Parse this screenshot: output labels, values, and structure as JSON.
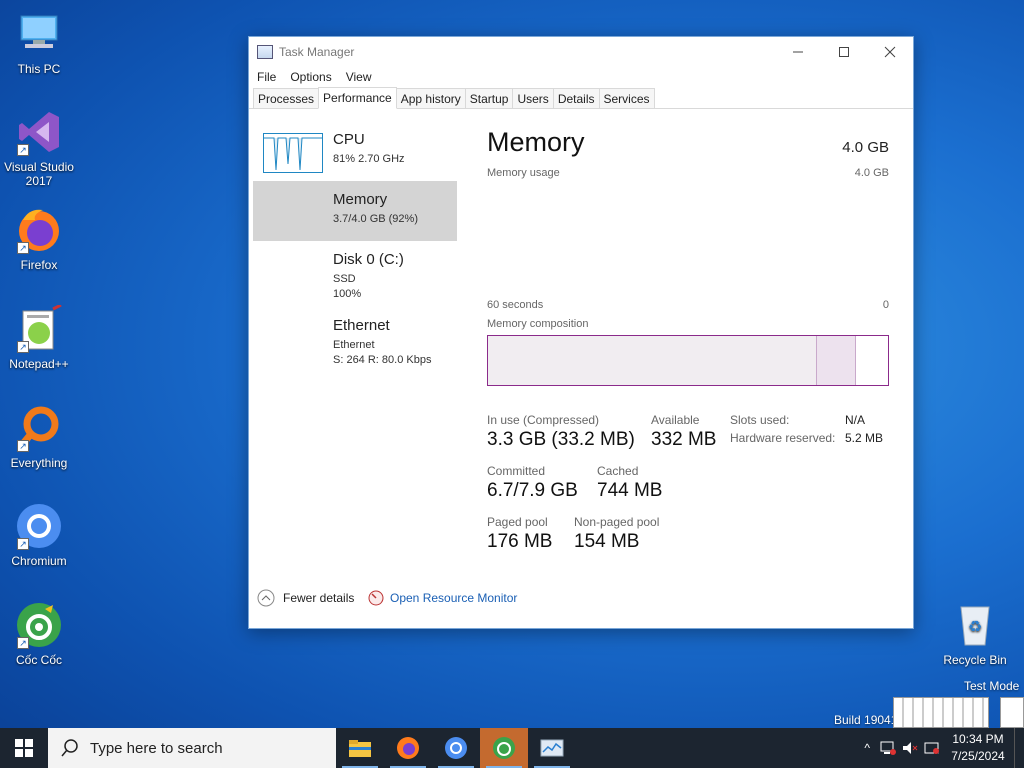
{
  "desktop": {
    "icons": [
      {
        "label": "This PC"
      },
      {
        "label": "Visual Studio 2017"
      },
      {
        "label": "Firefox"
      },
      {
        "label": "Notepad++"
      },
      {
        "label": "Everything"
      },
      {
        "label": "Chromium"
      },
      {
        "label": "Cốc Cốc"
      },
      {
        "label": "Recycle Bin"
      }
    ],
    "watermark_mode": "Test Mode",
    "watermark_build": "Build 19041"
  },
  "window": {
    "title": "Task Manager",
    "menu": [
      "File",
      "Options",
      "View"
    ],
    "tabs": [
      "Processes",
      "Performance",
      "App history",
      "Startup",
      "Users",
      "Details",
      "Services"
    ],
    "active_tab": "Performance"
  },
  "sidebar": {
    "items": [
      {
        "name": "CPU",
        "line1": "81%  2.70 GHz",
        "line2": ""
      },
      {
        "name": "Memory",
        "line1": "3.7/4.0 GB (92%)",
        "line2": ""
      },
      {
        "name": "Disk 0 (C:)",
        "line1": "SSD",
        "line2": "100%"
      },
      {
        "name": "Ethernet",
        "line1": "Ethernet",
        "line2": "S: 264  R: 80.0 Kbps"
      }
    ]
  },
  "memory": {
    "title": "Memory",
    "total": "4.0 GB",
    "usage_label": "Memory usage",
    "usage_max": "4.0 GB",
    "time_label": "60 seconds",
    "time_zero": "0",
    "composition_label": "Memory composition",
    "composition": {
      "in_use_fraction": 0.82,
      "modified_fraction": 0.1,
      "standby_fraction": 0.0,
      "free_fraction": 0.08
    },
    "stats": {
      "in_use_label": "In use (Compressed)",
      "in_use_value": "3.3 GB (33.2 MB)",
      "available_label": "Available",
      "available_value": "332 MB",
      "committed_label": "Committed",
      "committed_value": "6.7/7.9 GB",
      "cached_label": "Cached",
      "cached_value": "744 MB",
      "paged_label": "Paged pool",
      "paged_value": "176 MB",
      "nonpaged_label": "Non-paged pool",
      "nonpaged_value": "154 MB",
      "slots_label": "Slots used:",
      "slots_value": "N/A",
      "hw_label": "Hardware reserved:",
      "hw_value": "5.2 MB"
    },
    "fewer_details": "Fewer details",
    "open_resmon": "Open Resource Monitor"
  },
  "colors": {
    "accent": "#8b2a8b",
    "link": "#1a5fb4",
    "cpu_graph": "#1f87c3"
  },
  "taskbar": {
    "search_placeholder": "Type here to search",
    "time": "10:34 PM",
    "date": "7/25/2024"
  }
}
